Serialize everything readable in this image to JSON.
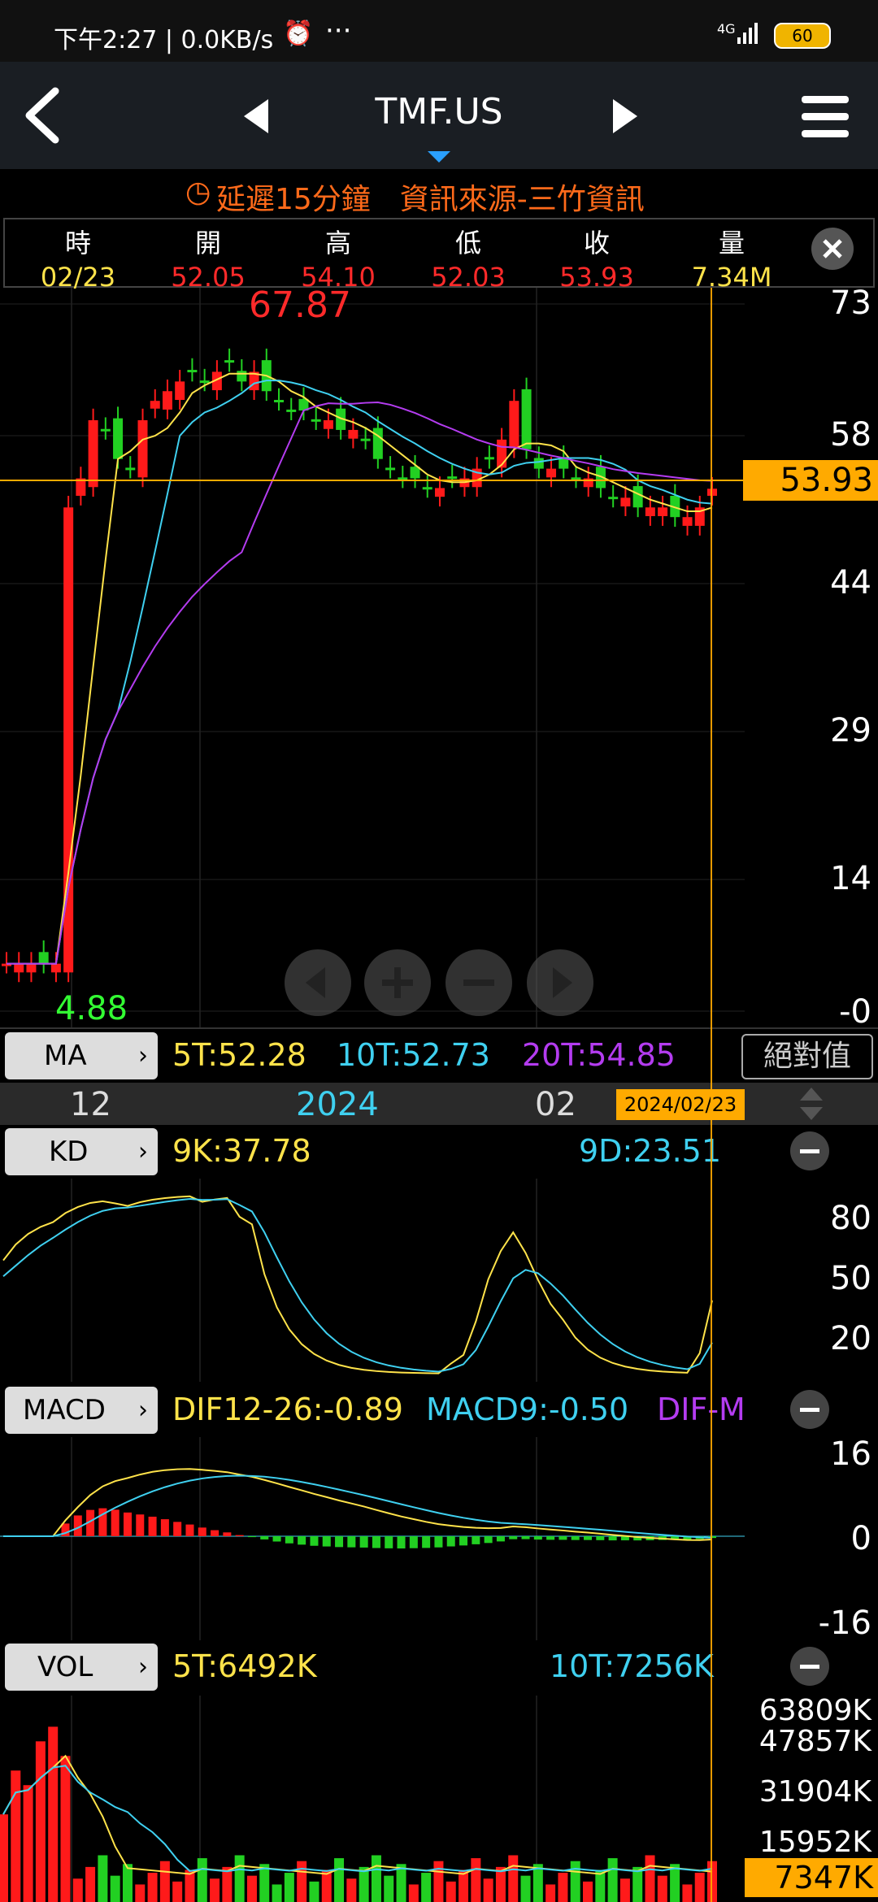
{
  "status": {
    "left": "下午2:27 | 0.0KB/s",
    "net": "4G",
    "battery": "60"
  },
  "header": {
    "title": "TMF.US"
  },
  "delay_notice": "延遲15分鐘　資訊來源-三竹資訊",
  "quote": {
    "headers": [
      "時",
      "開",
      "高",
      "低",
      "收",
      "量"
    ],
    "values": [
      "02/23",
      "52.05",
      "54.10",
      "52.03",
      "53.93",
      "7.34M"
    ]
  },
  "main_chart": {
    "high_label": "67.87",
    "low_label": "4.88",
    "last_label": "53.93",
    "y_ticks": [
      "73",
      "58",
      "44",
      "29",
      "14",
      "-0"
    ]
  },
  "ma": {
    "button": "MA",
    "ma5": "5T:52.28",
    "ma10": "10T:52.73",
    "ma20": "20T:54.85",
    "mode_button": "絕對值"
  },
  "time_axis": {
    "labels": [
      "12",
      "2024",
      "02"
    ],
    "cursor_date": "2024/02/23"
  },
  "kd": {
    "button": "KD",
    "k": "9K:37.78",
    "d": "9D:23.51",
    "y_ticks": [
      "80",
      "50",
      "20"
    ]
  },
  "macd": {
    "button": "MACD",
    "dif": "DIF12-26:-0.89",
    "macd": "MACD9:-0.50",
    "osc": "DIF-M",
    "y_ticks": [
      "16",
      "0",
      "-16"
    ]
  },
  "vol": {
    "button": "VOL",
    "ma5": "5T:6492K",
    "ma10": "10T:7256K",
    "y_ticks": [
      "63809K",
      "47857K",
      "31904K",
      "15952K"
    ],
    "last": "7347K"
  },
  "colors": {
    "up": "#ff1a1a",
    "down": "#22d022",
    "ma5": "#ffe34a",
    "ma10": "#3fd0f0",
    "ma20": "#b43cf0",
    "accent": "#ffaa00"
  },
  "chart_data": {
    "type": "candlestick",
    "title": "TMF.US",
    "x": [
      "12",
      "2024",
      "02",
      "2024/02/23"
    ],
    "ohlc_last": {
      "date": "02/23",
      "open": 52.05,
      "high": 54.1,
      "low": 52.03,
      "close": 53.93,
      "volume": "7.34M"
    },
    "close_series": [
      4.9,
      4.9,
      4.9,
      4.9,
      4.9,
      52,
      55,
      61,
      60,
      57,
      56,
      61,
      63,
      64,
      65,
      66,
      65,
      66,
      67,
      65,
      66,
      64,
      63,
      62,
      62,
      61,
      61,
      60,
      60,
      59,
      57,
      56,
      55,
      55,
      54,
      54,
      55,
      55,
      56,
      57,
      59,
      63,
      58,
      56,
      56,
      56,
      55,
      55,
      54,
      53,
      53,
      52,
      52,
      52,
      51,
      51,
      52,
      53.93
    ],
    "ylim": [
      0,
      73
    ]
  }
}
